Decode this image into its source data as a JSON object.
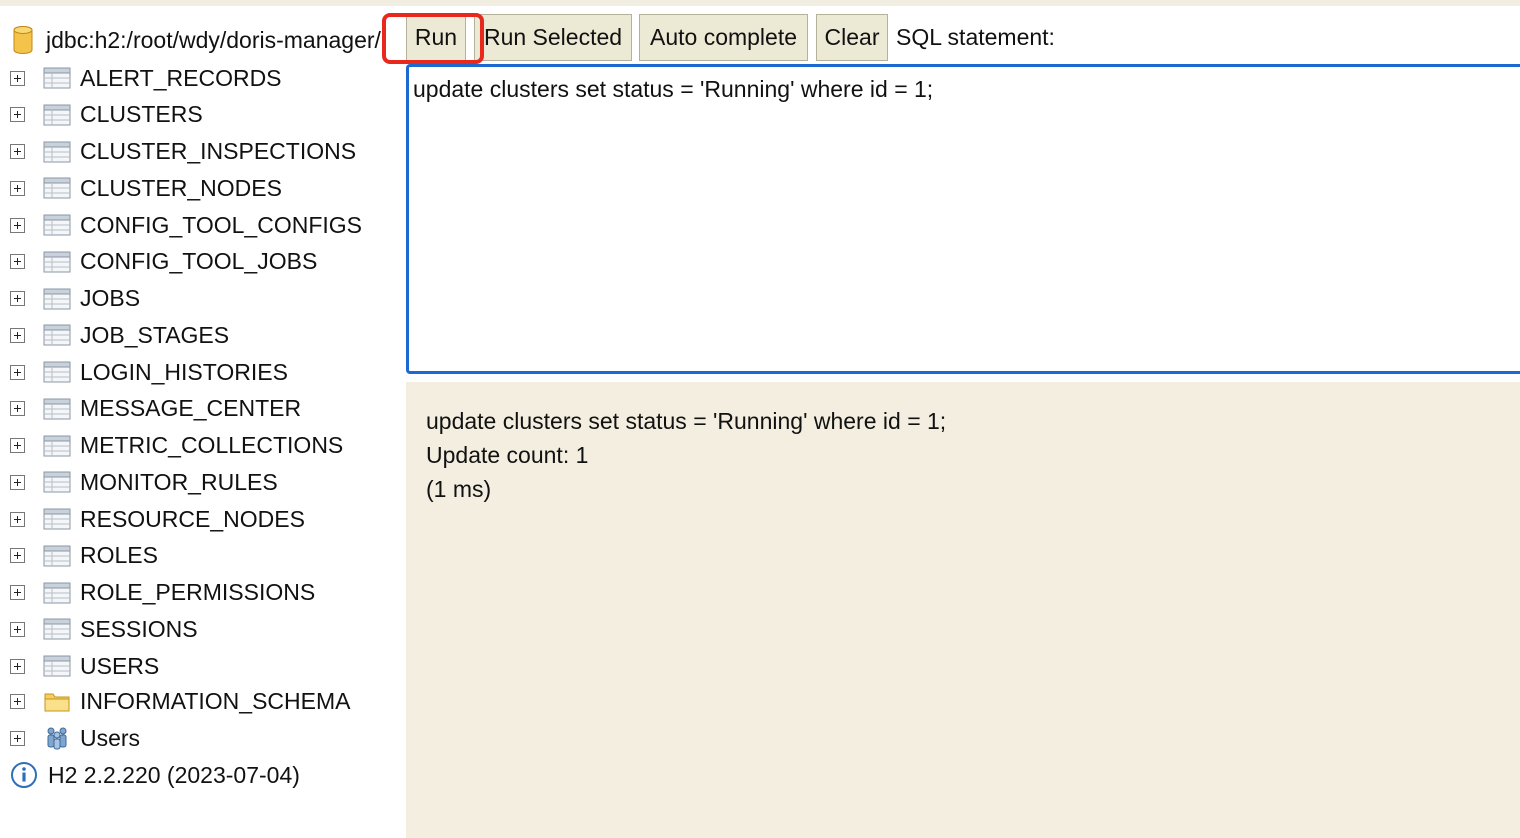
{
  "connection": {
    "url": "jdbc:h2:/root/wdy/doris-manager/",
    "icon": "database-icon"
  },
  "tree": {
    "tables": [
      {
        "label": "ALERT_RECORDS"
      },
      {
        "label": "CLUSTERS"
      },
      {
        "label": "CLUSTER_INSPECTIONS"
      },
      {
        "label": "CLUSTER_NODES"
      },
      {
        "label": "CONFIG_TOOL_CONFIGS"
      },
      {
        "label": "CONFIG_TOOL_JOBS"
      },
      {
        "label": "JOBS"
      },
      {
        "label": "JOB_STAGES"
      },
      {
        "label": "LOGIN_HISTORIES"
      },
      {
        "label": "MESSAGE_CENTER"
      },
      {
        "label": "METRIC_COLLECTIONS"
      },
      {
        "label": "MONITOR_RULES"
      },
      {
        "label": "RESOURCE_NODES"
      },
      {
        "label": "ROLES"
      },
      {
        "label": "ROLE_PERMISSIONS"
      },
      {
        "label": "SESSIONS"
      },
      {
        "label": "USERS"
      }
    ],
    "schema": {
      "label": "INFORMATION_SCHEMA"
    },
    "users": {
      "label": "Users"
    },
    "version": "H2 2.2.220 (2023-07-04)"
  },
  "toolbar": {
    "run": "Run",
    "run_selected": "Run Selected",
    "auto_complete": "Auto complete",
    "clear": "Clear",
    "sql_label": "SQL statement:"
  },
  "editor": {
    "value": "update clusters set status = 'Running' where id = 1;"
  },
  "result": {
    "statement": "update clusters set status = 'Running' where id = 1;",
    "update_count": "Update count: 1",
    "timing": "(1 ms)"
  },
  "colors": {
    "highlight": "#e8281c",
    "editor_border": "#1c69d3",
    "result_bg": "#f3eee0",
    "button_bg": "#ece9d4"
  }
}
